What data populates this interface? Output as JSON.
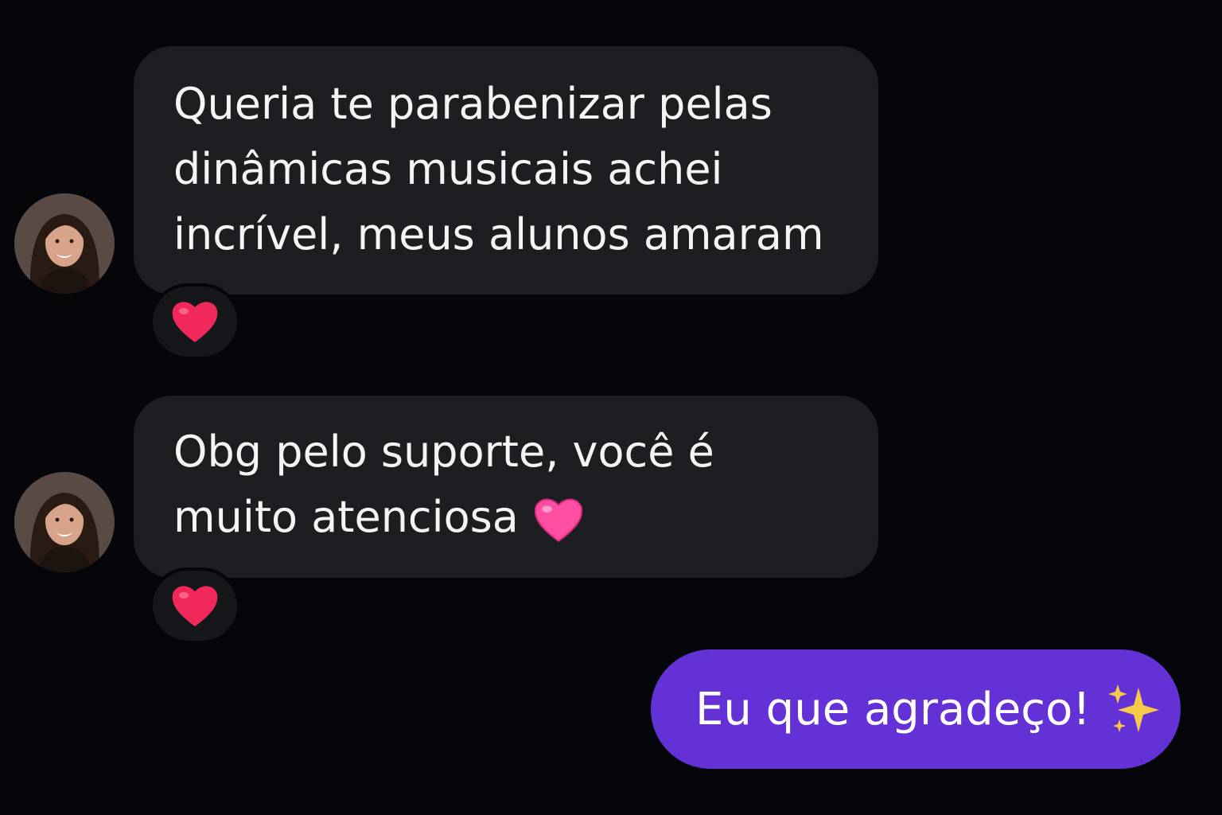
{
  "conversation": {
    "messages": [
      {
        "direction": "incoming",
        "lines": [
          "Queria te parabenizar pelas",
          "dinâmicas musicais achei",
          "incrível, meus alunos amaram"
        ],
        "reaction": "red-heart-icon"
      },
      {
        "direction": "incoming",
        "lines": [
          "Obg pelo suporte, você é",
          "muito atenciosa"
        ],
        "inline_emoji": "pink-heart-icon",
        "reaction": "red-heart-icon"
      },
      {
        "direction": "outgoing",
        "text": "Eu que agradeço!",
        "inline_emoji": "sparkles-icon"
      }
    ]
  },
  "colors": {
    "background": "#05060a",
    "incoming_bubble": "#1d1e22",
    "outgoing_bubble": "#6331d6",
    "reaction_heart": "#f0295a",
    "pink_heart": "#ff4fa3",
    "sparkles": "#f7c948"
  }
}
